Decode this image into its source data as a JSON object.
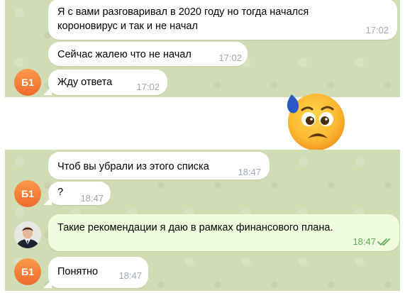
{
  "chat": {
    "messages": [
      {
        "line1": "Я с вами разговаривал в 2020 году но тогда начался",
        "line2": "короновирус и так и не начал",
        "time": "17:02"
      },
      {
        "text": "Сейчас жалею что не начал",
        "time": "17:02"
      },
      {
        "text": "Жду ответа",
        "time": "17:02"
      },
      {
        "emoji": "anxious-face-with-sweat"
      },
      {
        "text": "Чтоб вы убрали из этого списка",
        "time": "18:47"
      },
      {
        "text": "?",
        "time": "18:47"
      },
      {
        "text": "Такие рекомендации я даю в рамках финансового плана.",
        "time": "18:47",
        "status": "read"
      },
      {
        "text": "Понятно",
        "time": "18:47"
      }
    ],
    "avatar_initials": "Б1",
    "colors": {
      "background": "#cfdcb4",
      "incoming_bubble": "#ffffff",
      "outgoing_bubble": "#effdde",
      "outgoing_time": "#5fad5a",
      "avatar": "#f27a36"
    }
  }
}
